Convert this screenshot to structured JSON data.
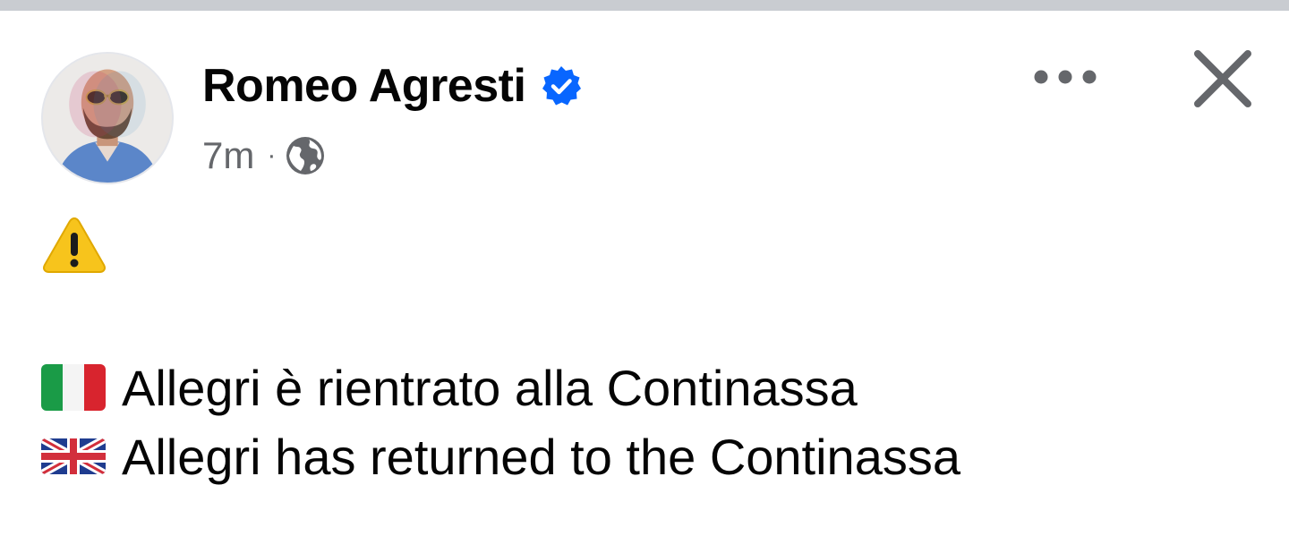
{
  "post": {
    "author": "Romeo Agresti",
    "verified": true,
    "time": "7m",
    "separator": "·",
    "audience_icon": "globe-icon",
    "body": {
      "warning_icon": "warning-sign-icon",
      "lines": [
        {
          "flag_icon": "italy-flag-icon",
          "text": "Allegri è rientrato alla Continassa"
        },
        {
          "flag_icon": "uk-flag-icon",
          "text": "Allegri has returned to the Continassa"
        }
      ]
    }
  },
  "header_actions": {
    "more_icon": "more-options-icon",
    "close_icon": "close-icon"
  },
  "colors": {
    "verified_blue": "#0866ff",
    "secondary_text": "#65676b",
    "primary_text": "#050505",
    "top_bar": "#c9ccd1"
  }
}
